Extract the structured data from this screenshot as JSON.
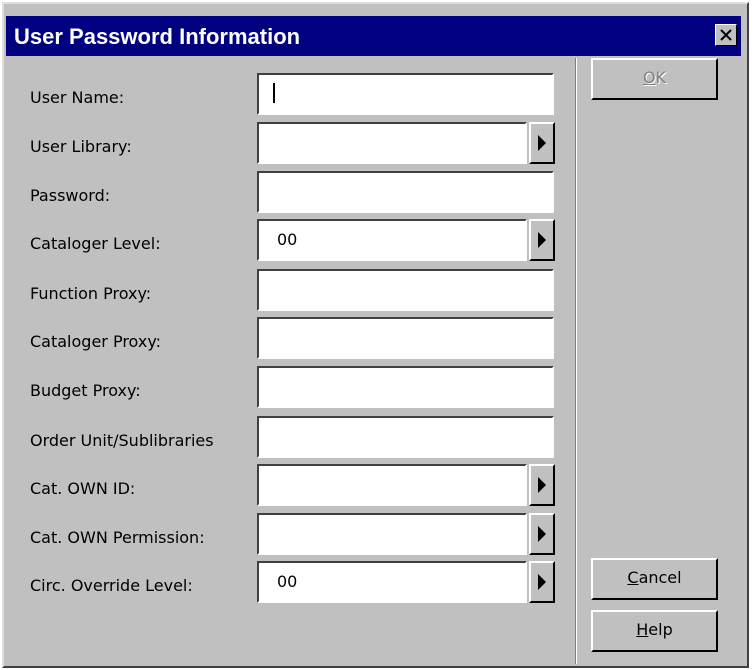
{
  "window": {
    "title": "User Password Information",
    "title_bar_color": "#000080",
    "close_icon": "close-icon"
  },
  "fields": [
    {
      "label": "User Name:",
      "value": "",
      "has_arrow": false
    },
    {
      "label": "User Library:",
      "value": "",
      "has_arrow": true
    },
    {
      "label": "Password:",
      "value": "",
      "has_arrow": false
    },
    {
      "label": "Cataloger Level:",
      "value": "00",
      "has_arrow": true
    },
    {
      "label": "Function Proxy:",
      "value": "",
      "has_arrow": false
    },
    {
      "label": "Cataloger Proxy:",
      "value": "",
      "has_arrow": false
    },
    {
      "label": "Budget Proxy:",
      "value": "",
      "has_arrow": false
    },
    {
      "label": "Order Unit/Sublibraries",
      "value": "",
      "has_arrow": false
    },
    {
      "label": "Cat. OWN ID:",
      "value": "",
      "has_arrow": true
    },
    {
      "label": "Cat. OWN Permission:",
      "value": "",
      "has_arrow": true
    },
    {
      "label": "Circ. Override Level:",
      "value": "00",
      "has_arrow": true
    }
  ],
  "buttons": {
    "ok": {
      "label_first": "O",
      "label_rest": "K",
      "enabled": false
    },
    "cancel": {
      "label_first": "C",
      "label_rest": "ancel",
      "enabled": true
    },
    "help": {
      "label_first": "H",
      "label_rest": "elp",
      "enabled": true
    }
  }
}
